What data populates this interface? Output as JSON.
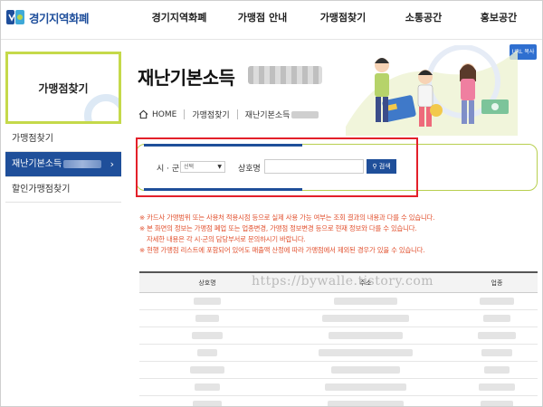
{
  "header": {
    "logo_text": "경기지역화폐",
    "nav": [
      "경기지역화폐",
      "가맹점 안내",
      "가맹점찾기",
      "소통공간",
      "홍보공간"
    ]
  },
  "sidebar": {
    "title": "가맹점찾기",
    "items": [
      {
        "label": "가맹점찾기"
      },
      {
        "label": "재난기본소득"
      },
      {
        "label": "할인가맹점찾기"
      }
    ]
  },
  "page": {
    "title": "재난기본소득",
    "url_button": "URL 복사",
    "breadcrumb": [
      "HOME",
      "가맹점찾기",
      "재난기본소득"
    ]
  },
  "search": {
    "sigun_label": "시 · 군",
    "sigun_selected": "선택",
    "name_label": "상호명",
    "name_value": "",
    "search_button": "검색"
  },
  "notices": [
    "※ 카드사 가맹범위 또는 사용처 적용시점 등으로 실제 사용 가능 여부는 조회 결과의 내용과 다를 수 있습니다.",
    "※ 본 화면의 정보는 가맹점 폐업 또는 업종변경, 가맹점 정보변경 등으로 현재 정보와 다를 수 있습니다.",
    "자세한 내용은 각 시·군의 담당부서로 문의하시기 바랍니다.",
    "※ 현행 가맹점 리스트에 포함되어 있어도 매출액 산정에 따라 가맹점에서 제외된 경우가 있을 수 있습니다."
  ],
  "table": {
    "headers": [
      "상호명",
      "주소",
      "업종"
    ],
    "row_count": 7
  },
  "watermark": "https://bywalle.tistory.com",
  "colors": {
    "brand_blue": "#1f4f9a",
    "lime": "#c5d94a",
    "notice_red": "#e2502e",
    "highlight_red": "#e3202a"
  }
}
